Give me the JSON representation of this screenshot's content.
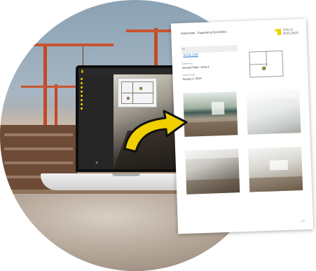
{
  "app": {
    "topbar_links": [
      "",
      "",
      ""
    ],
    "sidebar_items": [
      "",
      "",
      "",
      "",
      "",
      "",
      "",
      ""
    ],
    "add_symbol": "+"
  },
  "report": {
    "title": "HoloCenter - Exported at 01/19/2021",
    "brand": {
      "line1": "HOLO",
      "line2": "BUILDER"
    },
    "fields": [
      {
        "label": "Site",
        "value": "S.CK.134",
        "is_link": true
      },
      {
        "label": "Sheet/Area",
        "value": "Ground Floor / Area A"
      },
      {
        "label": "Capture Date",
        "value": "August 2, 2019"
      }
    ],
    "page_number": "1/2"
  },
  "colors": {
    "brand_yellow": "#f0d000",
    "link_blue": "#2c6fd1"
  }
}
